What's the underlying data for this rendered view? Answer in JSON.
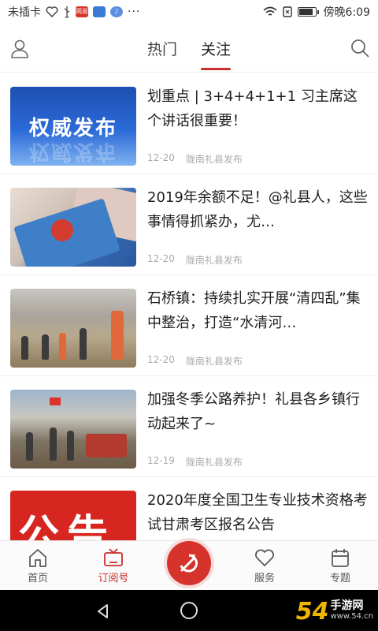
{
  "status_bar": {
    "carrier": "未插卡",
    "app_badge": "网易",
    "time": "傍晚6:09",
    "battery_level": 0.85
  },
  "header": {
    "tabs": [
      {
        "label": "热门",
        "active": false
      },
      {
        "label": "关注",
        "active": true
      }
    ]
  },
  "feed": [
    {
      "title": "划重点 | 3+4+4+1+1 习主席这个讲话很重要！",
      "date": "12-20",
      "source": "陇南礼县发布",
      "thumb_text": "权威发布"
    },
    {
      "title": "2019年余额不足！@礼县人，这些事情得抓紧办，尤…",
      "date": "12-20",
      "source": "陇南礼县发布"
    },
    {
      "title": "石桥镇：持续扎实开展“清四乱”集中整治，打造“水清河…",
      "date": "12-20",
      "source": "陇南礼县发布"
    },
    {
      "title": "加强冬季公路养护！礼县各乡镇行动起来了~",
      "date": "12-19",
      "source": "陇南礼县发布"
    },
    {
      "title": "2020年度全国卫生专业技术资格考试甘肃考区报名公告",
      "date": "",
      "source": "",
      "thumb_text": "公告"
    }
  ],
  "bottom_nav": [
    {
      "label": "首页",
      "icon": "home-icon",
      "active": false
    },
    {
      "label": "订阅号",
      "icon": "tv-icon",
      "active": true
    },
    {
      "label": "",
      "icon": "party-emblem-icon",
      "active": false
    },
    {
      "label": "服务",
      "icon": "heart-icon",
      "active": false
    },
    {
      "label": "专题",
      "icon": "calendar-icon",
      "active": false
    }
  ],
  "watermark": {
    "number": "54",
    "text": "手游网",
    "url": "www.54.cn"
  },
  "colors": {
    "accent": "#c9302c",
    "party_red": "#d6332d"
  }
}
